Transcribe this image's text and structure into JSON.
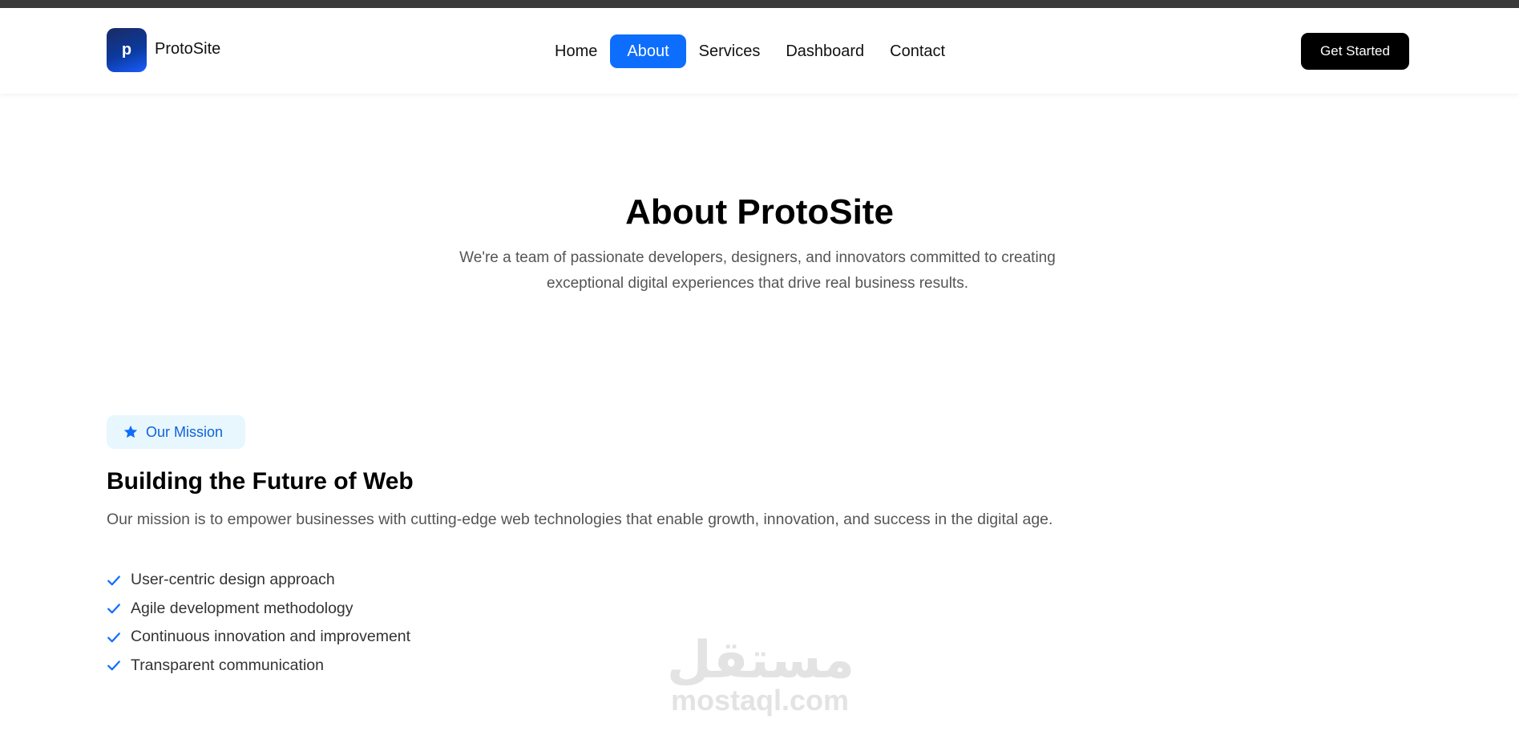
{
  "header": {
    "logo_letter": "p",
    "brand": "ProtoSite",
    "nav": [
      {
        "label": "Home",
        "active": false
      },
      {
        "label": "About",
        "active": true
      },
      {
        "label": "Services",
        "active": false
      },
      {
        "label": "Dashboard",
        "active": false
      },
      {
        "label": "Contact",
        "active": false
      }
    ],
    "cta_label": "Get Started"
  },
  "hero": {
    "title": "About ProtoSite",
    "subtitle_line1": "We're a team of passionate developers, designers, and innovators committed to creating",
    "subtitle_line2": "exceptional digital experiences that drive real business results."
  },
  "mission": {
    "badge_icon": "star-icon",
    "badge_label": "Our Mission",
    "title": "Building the Future of Web",
    "description": "Our mission is to empower businesses with cutting-edge web technologies that enable growth, innovation, and success in the digital age.",
    "features": [
      "User-centric design approach",
      "Agile development methodology",
      "Continuous innovation and improvement",
      "Transparent communication"
    ],
    "feature_icon": "check-icon"
  },
  "watermark": {
    "arabic": "مستقل",
    "latin": "mostaql.com"
  },
  "colors": {
    "accent": "#0d6efd",
    "cta_bg": "#000000",
    "pill_bg": "#e8f6fd"
  }
}
